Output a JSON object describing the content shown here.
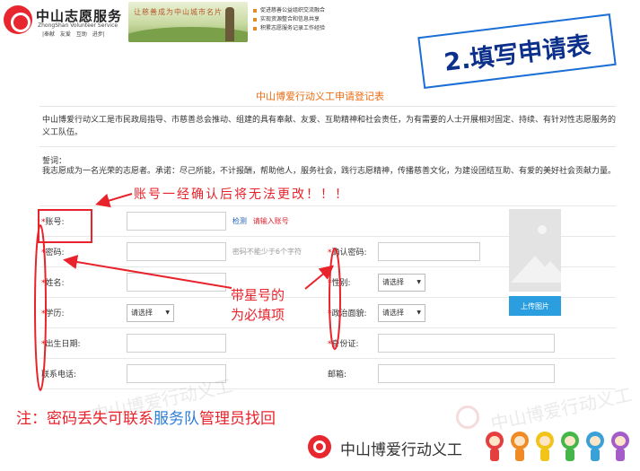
{
  "header": {
    "logo_name": "中山志愿服务",
    "logo_en": "ZhongShan Volunteer Service",
    "logo_sub": "|奉献 友爱 互助 进步|",
    "banner_slogan": "让慈善成为中山城市名片",
    "bullets": [
      "促进慈善公益组织交流融合",
      "实现资源整合和信息共享",
      "积累志愿服务记录工作经验"
    ]
  },
  "step_badge": "2.填写申请表",
  "form": {
    "title": "中山博爱行动义工申请登记表",
    "intro": "中山博爱行动义工是市民政局指导、市慈善总会推动、组建的具有奉献、友爱、互助精神和社会责任，为有需要的人士开展相对固定、持续、有针对性志愿服务的义工队伍。",
    "pledge_title": "誓词：",
    "pledge_text": "我志愿成为一名光荣的志愿者。承诺：尽己所能，不计报酬，帮助他人，服务社会，践行志愿精神，传播慈善文化，为建设团结互助、有爱的美好社会贡献力量。",
    "required_mark": "*",
    "fields": {
      "account_label": "账号:",
      "account_check_link": "检测",
      "account_check_msg": "请输入账号",
      "password_label": "密码:",
      "password_hint": "密码不能少于6个字符",
      "confirm_password_label": "确认密码:",
      "name_label": "姓名:",
      "gender_label": "性别:",
      "gender_value": "请选择",
      "education_label": "学历:",
      "education_value": "请选择",
      "political_label": "政治面貌:",
      "political_value": "请选择",
      "birthdate_label": "出生日期:",
      "id_card_label": "身份证:",
      "phone_label": "联系电话:",
      "email_label": "邮箱:"
    },
    "upload_button": "上传图片"
  },
  "annotations": {
    "account_warning": "账号一经确认后将无法更改！！！",
    "star_note_line1": "带星号的",
    "star_note_line2": "为必填项",
    "bottom_note_prefix": "注：密码丢失可联系",
    "bottom_note_highlight": "服务队",
    "bottom_note_suffix": "管理员找回",
    "color_red": "#e8232b",
    "color_blue": "#2b7bd8"
  },
  "footer": {
    "org_name": "中山博爱行动义工",
    "watermark": "中山博爱行动义工"
  }
}
